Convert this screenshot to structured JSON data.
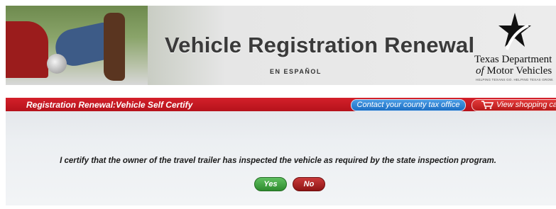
{
  "header": {
    "title": "Vehicle Registration Renewal",
    "espanol_link": "EN ESPAÑOL",
    "logo": {
      "line1": "Texas Department",
      "line2_italic": "of",
      "line2_rest": " Motor Vehicles",
      "tagline": "HELPING TEXANS GO. HELPING TEXAS GROW."
    }
  },
  "nav": {
    "section_title": "Registration Renewal:Vehicle Self Certify",
    "contact_button": "Contact your county tax office",
    "cart_button": "View shopping cart"
  },
  "main": {
    "certify_text": "I certify that the owner of the travel trailer has inspected the vehicle as required by the state inspection program.",
    "yes_label": "Yes",
    "no_label": "No"
  },
  "colors": {
    "red_bar": "#c41a23",
    "contact_blue": "#2a7fd0",
    "yes_green": "#3b9b3b",
    "no_red": "#a61d1d"
  },
  "icons": {
    "cart": "shopping-cart-icon",
    "logo_star": "star-icon"
  }
}
